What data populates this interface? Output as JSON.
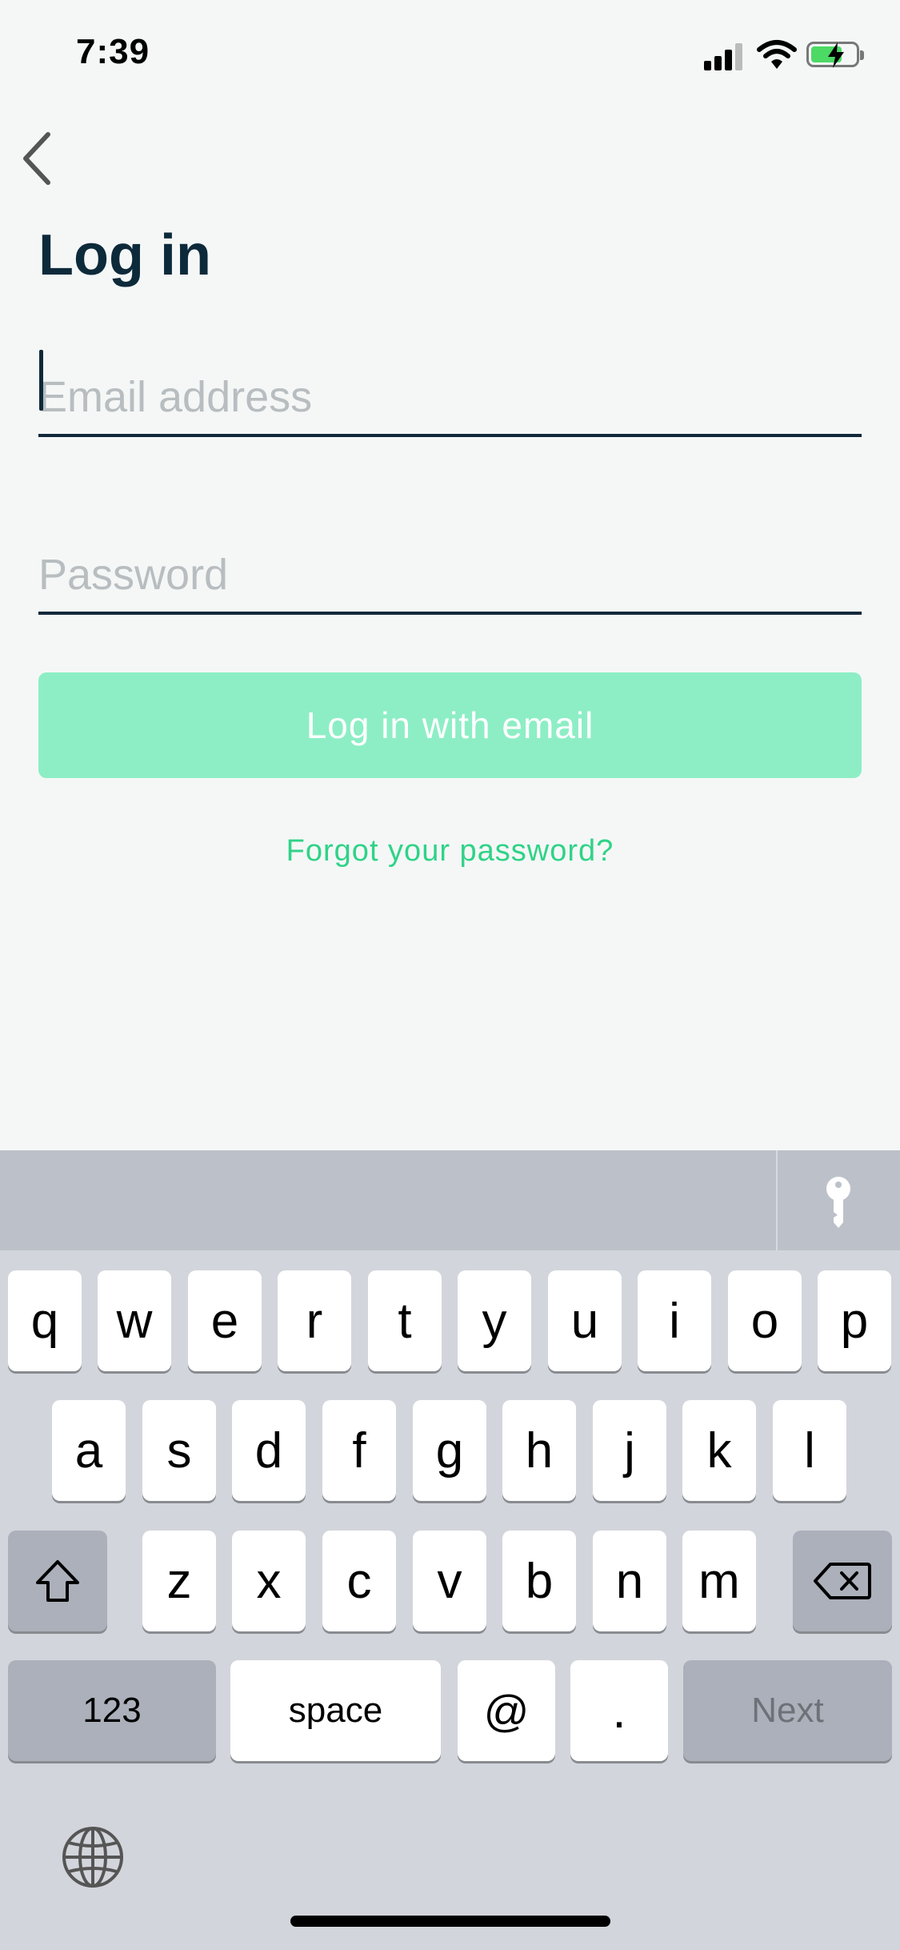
{
  "status": {
    "time": "7:39"
  },
  "page": {
    "title": "Log in"
  },
  "form": {
    "email_placeholder": "Email address",
    "email_value": "",
    "password_placeholder": "Password",
    "password_value": "",
    "submit_label": "Log in with email",
    "forgot_label": "Forgot your password?"
  },
  "colors": {
    "accent": "#2fd387",
    "button_disabled": "#8deec5",
    "text_dark": "#0d2a3a"
  },
  "keyboard": {
    "row1": [
      "q",
      "w",
      "e",
      "r",
      "t",
      "y",
      "u",
      "i",
      "o",
      "p"
    ],
    "row2": [
      "a",
      "s",
      "d",
      "f",
      "g",
      "h",
      "j",
      "k",
      "l"
    ],
    "row3": [
      "z",
      "x",
      "c",
      "v",
      "b",
      "n",
      "m"
    ],
    "numbers_label": "123",
    "space_label": "space",
    "at_label": "@",
    "dot_label": ".",
    "next_label": "Next",
    "icons": {
      "shift": "shift-icon",
      "delete": "backspace-icon",
      "password": "key-icon",
      "language": "globe-icon"
    }
  }
}
